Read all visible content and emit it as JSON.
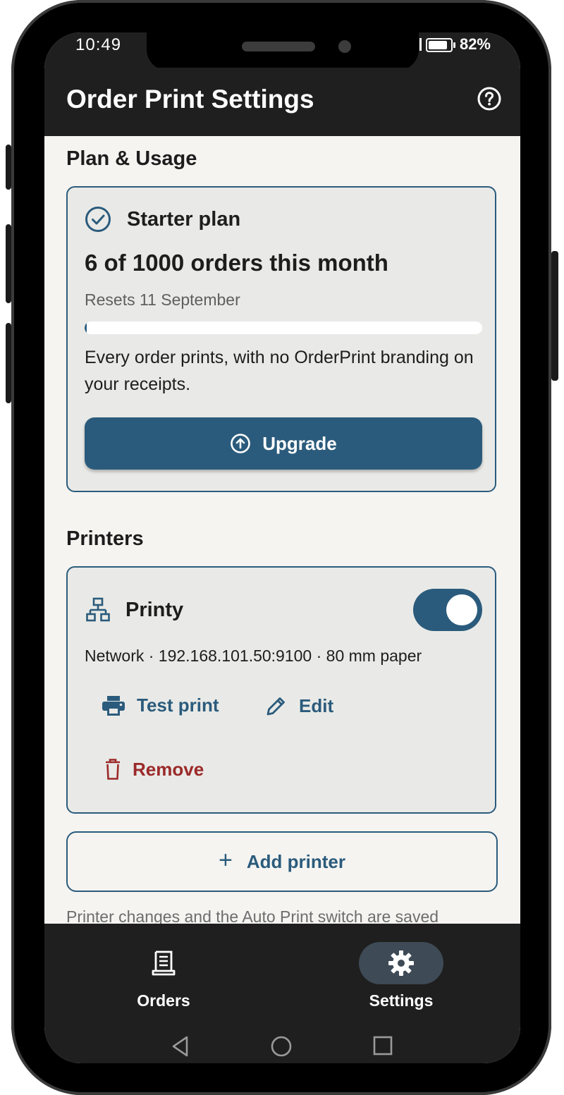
{
  "status_bar": {
    "time": "10:49",
    "battery": "82%"
  },
  "app_bar": {
    "title": "Order Print Settings",
    "help_icon": "help-circle-icon"
  },
  "plan_section": {
    "heading": "Plan & Usage",
    "plan_name": "Starter plan",
    "usage_text": "6 of 1000 orders this month",
    "usage_fraction": 0.006,
    "reset_text": "Resets 11 September",
    "description": "Every order prints, with no OrderPrint branding on your receipts.",
    "upgrade_label": "Upgrade"
  },
  "printers_section": {
    "heading": "Printers",
    "printer": {
      "name": "Printy",
      "enabled": true,
      "info": "Network · 192.168.101.50:9100 · 80 mm paper",
      "test_label": "Test print",
      "edit_label": "Edit",
      "remove_label": "Remove"
    },
    "add_label": "Add printer",
    "footnote": "Printer changes and the Auto Print switch are saved"
  },
  "bottom_nav": {
    "items": [
      {
        "label": "Orders",
        "icon": "receipt-icon",
        "active": false
      },
      {
        "label": "Settings",
        "icon": "gear-icon",
        "active": true
      }
    ]
  },
  "colors": {
    "accent": "#2b5b7c",
    "danger": "#9b2a2a",
    "bar": "#1f1f1f",
    "card": "#e9eae7",
    "background": "#f5f4f1"
  }
}
